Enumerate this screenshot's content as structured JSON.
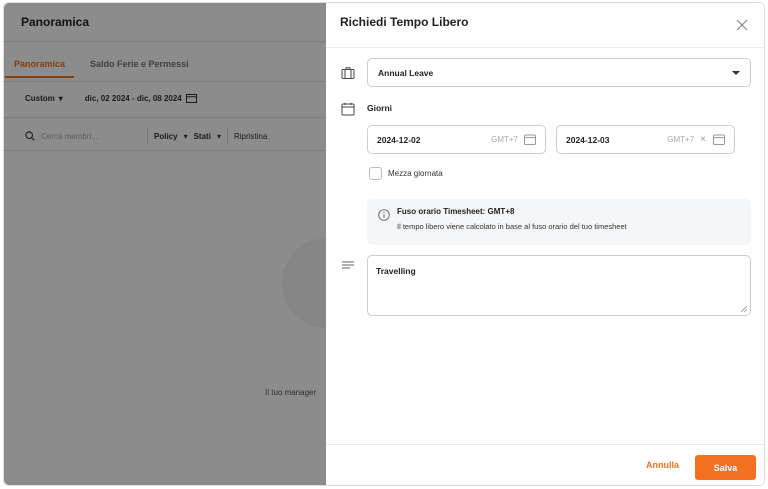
{
  "background": {
    "title": "Panoramica",
    "tabs": [
      {
        "label": "Panoramica",
        "active": true
      },
      {
        "label": "Saldo Ferie e Permessi",
        "active": false
      }
    ],
    "range_select": "Custom",
    "date_range": "dic, 02 2024 - dic, 08 2024",
    "search_placeholder": "Cerca membri...",
    "policy_filter": "Policy",
    "status_filter": "Stati",
    "reset_label": "Ripristina",
    "empty_text": "Il tuo manager"
  },
  "drawer": {
    "title": "Richiedi Tempo Libero",
    "leave_type": "Annual Leave",
    "days_label": "Giorni",
    "start_date": {
      "value": "2024-12-02",
      "tz": "GMT+7"
    },
    "end_date": {
      "value": "2024-12-03",
      "tz": "GMT+7"
    },
    "half_day_label": "Mezza giornata",
    "info": {
      "title": "Fuso orario Timesheet: GMT+8",
      "text": "Il tempo libero viene calcolato in base al fuso orario del tuo timesheet"
    },
    "note": "Travelling",
    "cancel_label": "Annulla",
    "save_label": "Salva"
  },
  "colors": {
    "accent": "#f37021",
    "overlay": "rgba(0,0,0,0.45)",
    "info_bg": "#f4f6f8"
  },
  "icons": [
    "briefcase-icon",
    "calendar-icon",
    "lines-icon",
    "info-icon",
    "close-icon",
    "chevron-down-icon",
    "search-icon"
  ]
}
